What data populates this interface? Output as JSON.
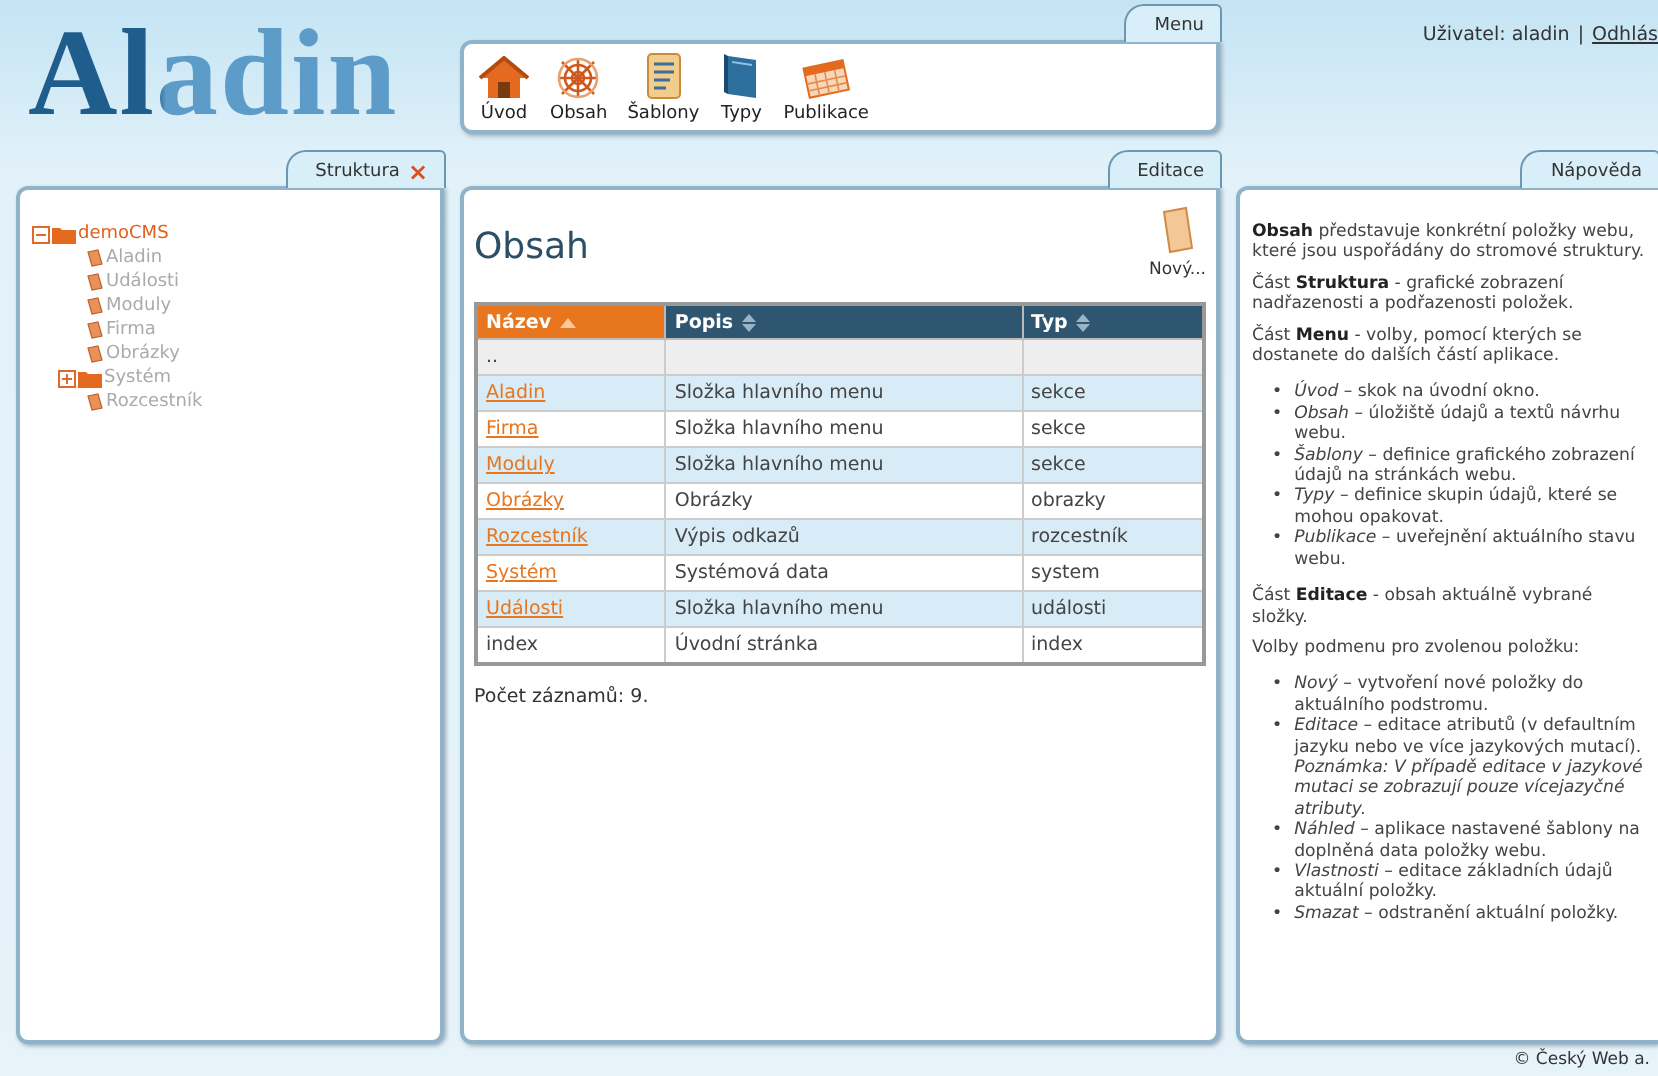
{
  "header": {
    "logo": "Aladin",
    "user": "Uživatel: aladin",
    "separator": "|",
    "logout": "Odhlás"
  },
  "menu": {
    "title": "Menu",
    "items": [
      {
        "label": "Úvod"
      },
      {
        "label": "Obsah"
      },
      {
        "label": "Šablony"
      },
      {
        "label": "Typy"
      },
      {
        "label": "Publikace"
      }
    ]
  },
  "structure": {
    "title": "Struktura",
    "close": "×",
    "tree": [
      {
        "label": "demoCMS",
        "kind": "folder",
        "expanded": true,
        "selected": true,
        "children": [
          {
            "label": "Aladin",
            "kind": "page",
            "selected": false
          },
          {
            "label": "Události",
            "kind": "page",
            "selected": false
          },
          {
            "label": "Moduly",
            "kind": "page",
            "selected": false
          },
          {
            "label": "Firma",
            "kind": "page",
            "selected": false
          },
          {
            "label": "Obrázky",
            "kind": "page",
            "selected": false
          },
          {
            "label": "Systém",
            "kind": "folder",
            "expanded": false,
            "selected": false
          },
          {
            "label": "Rozcestník",
            "kind": "page",
            "selected": false
          }
        ]
      }
    ]
  },
  "editor": {
    "title": "Editace",
    "heading": "Obsah",
    "new_button": "Nový...",
    "table": {
      "columns": [
        {
          "label": "Název",
          "sorted": true
        },
        {
          "label": "Popis",
          "sorted": false
        },
        {
          "label": "Typ",
          "sorted": false
        }
      ],
      "rows": [
        {
          "name": "..",
          "description": "",
          "type": "",
          "link": false
        },
        {
          "name": "Aladin",
          "description": "Složka hlavního menu",
          "type": "sekce",
          "link": true
        },
        {
          "name": "Firma",
          "description": "Složka hlavního menu",
          "type": "sekce",
          "link": true
        },
        {
          "name": "Moduly",
          "description": "Složka hlavního menu",
          "type": "sekce",
          "link": true
        },
        {
          "name": "Obrázky",
          "description": "Obrázky",
          "type": "obrazky",
          "link": true
        },
        {
          "name": "Rozcestník",
          "description": "Výpis odkazů",
          "type": "rozcestník",
          "link": true
        },
        {
          "name": "Systém",
          "description": "Systémová data",
          "type": "system",
          "link": true
        },
        {
          "name": "Události",
          "description": "Složka hlavního menu",
          "type": "události",
          "link": true
        },
        {
          "name": "index",
          "description": "Úvodní stránka",
          "type": "index",
          "link": false
        }
      ]
    },
    "record_count": "Počet záznamů: 9."
  },
  "help": {
    "title": "Nápověda",
    "blocks": [
      {
        "kind": "paragraph",
        "text": "**Obsah** představuje konkrétní položky webu, které jsou uspořádány do stromové struktury."
      },
      {
        "kind": "paragraph",
        "text": "Část **Struktura** - grafické zobrazení nadřazenosti a podřazenosti položek."
      },
      {
        "kind": "paragraph",
        "text": "Část **Menu** - volby, pomocí kterých se dostanete do dalších částí aplikace."
      },
      {
        "kind": "list",
        "items": [
          {
            "bullet": "•",
            "text": "*Úvod* – skok na úvodní okno."
          },
          {
            "bullet": "•",
            "text": "*Obsah* – úložiště údajů a textů návrhu webu."
          },
          {
            "bullet": "•",
            "text": "*Šablony* – definice grafického zobrazení údajů na stránkách webu."
          },
          {
            "bullet": "•",
            "text": "*Typy* – definice skupin údajů, které se mohou opakovat."
          },
          {
            "bullet": "•",
            "text": "*Publikace* – uveřejnění aktuálního stavu webu."
          }
        ]
      },
      {
        "kind": "paragraph",
        "text": "Část **Editace** - obsah aktuálně vybrané složky."
      },
      {
        "kind": "line",
        "text": "Volby podmenu pro zvolenou položku:"
      },
      {
        "kind": "list",
        "items": [
          {
            "bullet": "•",
            "text": "*Nový* – vytvoření nové položky do aktuálního podstromu."
          },
          {
            "bullet": "•",
            "text": "*Editace* – editace atributů (v defaultním jazyku nebo ve více jazykových mutací).",
            "note": "Poznámka: V případě editace v jazykové mutaci se zobrazují pouze vícejazyčné atributy."
          },
          {
            "bullet": "•",
            "text": "*Náhled* – aplikace nastavené šablony na doplněná data položky webu."
          },
          {
            "bullet": "•",
            "text": "*Vlastnosti* – editace základních údajů aktuální položky."
          },
          {
            "bullet": "•",
            "text": "*Smazat* – odstranění aktuální položky."
          }
        ]
      }
    ]
  },
  "footer": "© Český Web a."
}
